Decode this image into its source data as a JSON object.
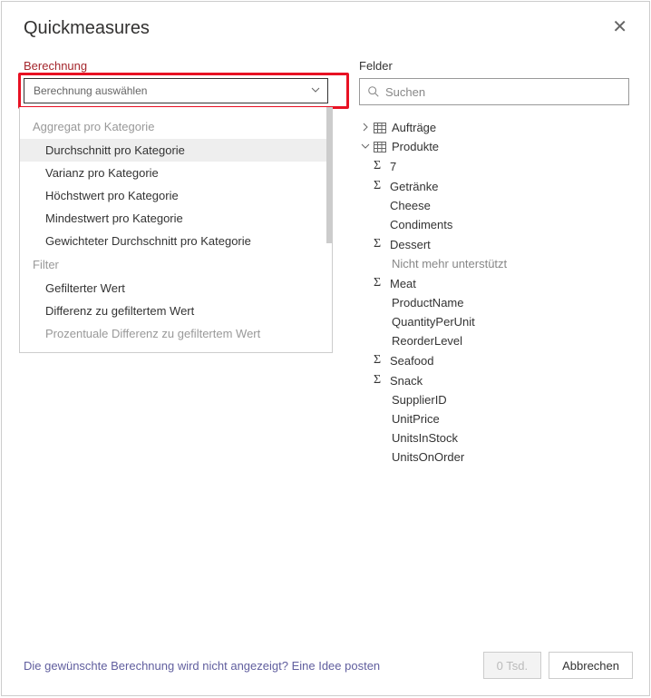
{
  "header": {
    "title": "Quickmeasures"
  },
  "left": {
    "label": "Berechnung",
    "dropdown_placeholder": "Berechnung auswählen",
    "groups": [
      {
        "header": "Aggregat pro Kategorie",
        "items": [
          {
            "label": "Durchschnitt pro Kategorie",
            "selected": true
          },
          {
            "label": "Varianz pro Kategorie"
          },
          {
            "label": "Höchstwert pro Kategorie"
          },
          {
            "label": "Mindestwert pro Kategorie"
          },
          {
            "label": "Gewichteter Durchschnitt pro Kategorie"
          }
        ]
      },
      {
        "header": "Filter",
        "items": [
          {
            "label": "Gefilterter Wert"
          },
          {
            "label": "Differenz zu gefiltertem Wert"
          },
          {
            "label": "Prozentuale Differenz zu gefiltertem Wert",
            "faded": true
          }
        ]
      }
    ]
  },
  "right": {
    "label": "Felder",
    "search_placeholder": "Suchen",
    "tree": [
      {
        "type": "table",
        "expanded": false,
        "label": "Aufträge"
      },
      {
        "type": "table",
        "expanded": true,
        "label": "Produkte",
        "children": [
          {
            "type": "measure",
            "label": "7"
          },
          {
            "type": "measure",
            "label": "Getränke"
          },
          {
            "type": "column",
            "label": "Cheese"
          },
          {
            "type": "column",
            "label": "Condiments"
          },
          {
            "type": "measure",
            "label": "Dessert"
          },
          {
            "type": "note",
            "label": "Nicht mehr unterstützt"
          },
          {
            "type": "measure",
            "label": "Meat"
          },
          {
            "type": "column",
            "label": "ProductName"
          },
          {
            "type": "column",
            "label": "QuantityPerUnit"
          },
          {
            "type": "column",
            "label": "ReorderLevel"
          },
          {
            "type": "measure",
            "label": "Seafood"
          },
          {
            "type": "measure",
            "label": "Snack"
          },
          {
            "type": "column",
            "label": "SupplierID"
          },
          {
            "type": "column",
            "label": "UnitPrice"
          },
          {
            "type": "column",
            "label": "UnitsInStock"
          },
          {
            "type": "column",
            "label": "UnitsOnOrder"
          }
        ]
      }
    ]
  },
  "footer": {
    "link_text": "Die gewünschte Berechnung wird nicht angezeigt? Eine Idee posten",
    "ok_label": "0 Tsd.",
    "cancel_label": "Abbrechen"
  }
}
